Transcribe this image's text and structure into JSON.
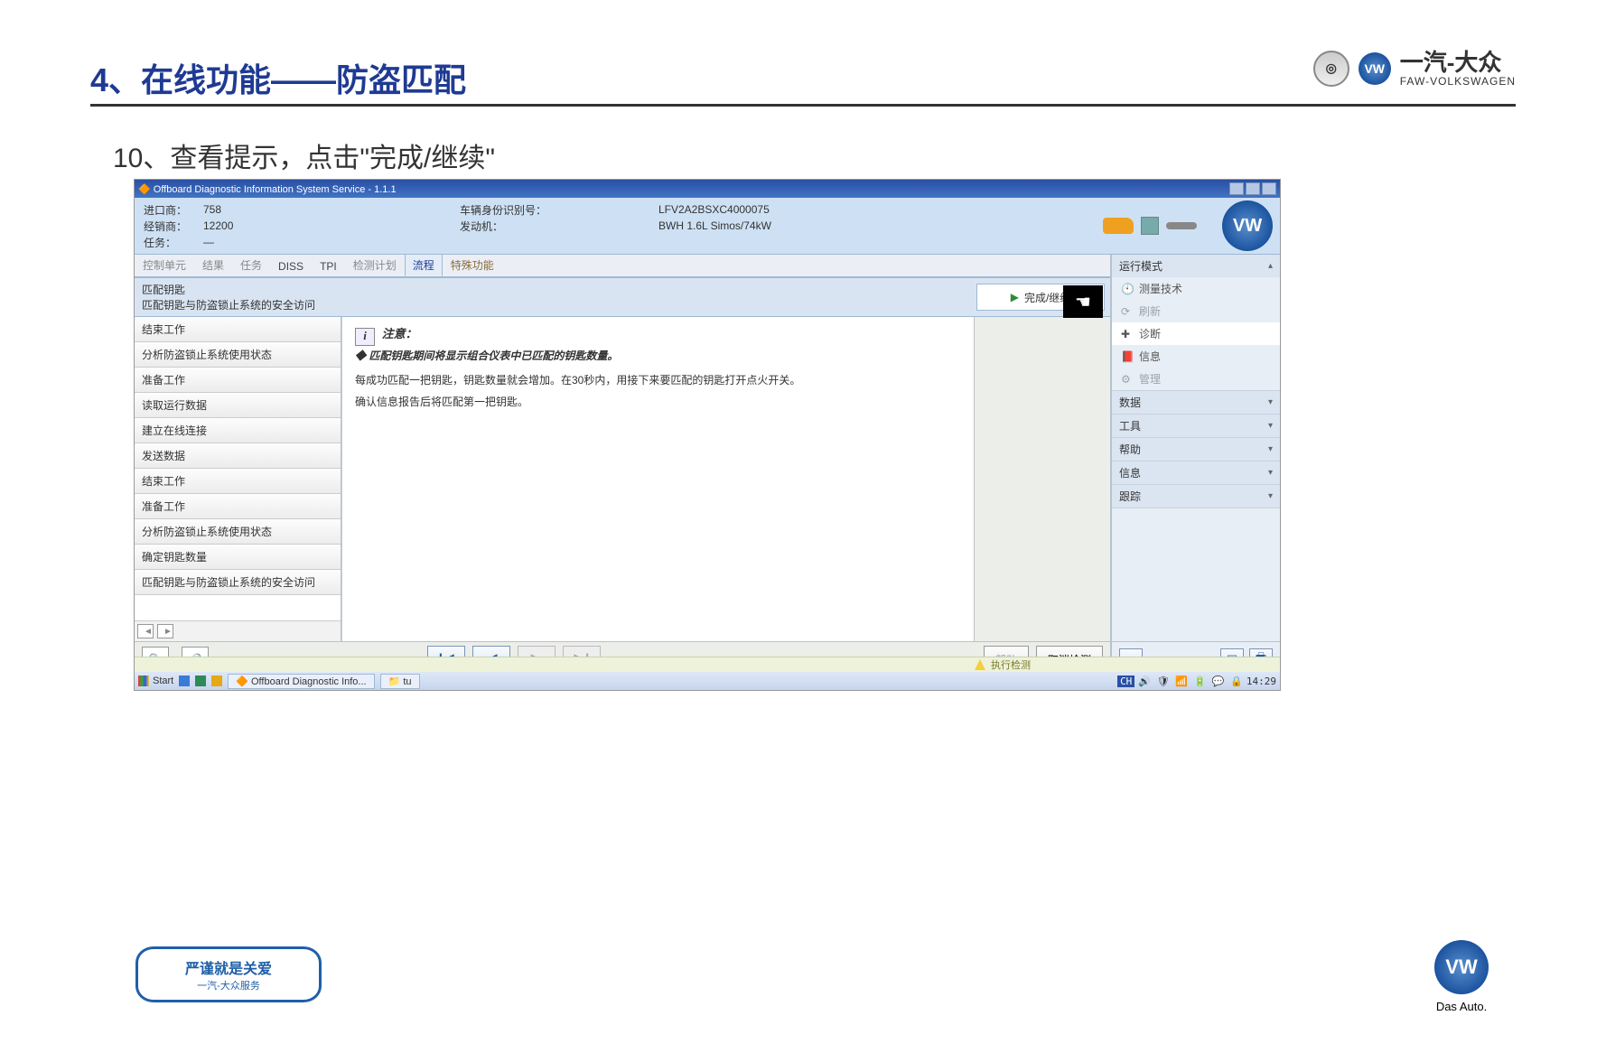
{
  "slide": {
    "title": "4、在线功能——防盗匹配",
    "subtitle": "10、查看提示，点击\"完成/继续\""
  },
  "brand": {
    "faw_vw_cn": "一汽-大众",
    "faw_vw_en": "FAW-VOLKSWAGEN",
    "badge_top": "严谨就是关爱",
    "badge_sub": "一汽-大众服务",
    "das_auto": "Das Auto."
  },
  "app": {
    "titlebar": "Offboard Diagnostic Information System Service - 1.1.1",
    "info": {
      "importer_label": "进口商：",
      "importer_value": "758",
      "dealer_label": "经销商：",
      "dealer_value": "12200",
      "task_label": "任务：",
      "task_value": "—",
      "vin_label": "车辆身份识别号：",
      "vin_value": "LFV2A2BSXC4000075",
      "engine_label": "发动机：",
      "engine_value": "BWH 1.6L Simos/74kW"
    },
    "tabs": [
      "控制单元",
      "结果",
      "任务",
      "DISS",
      "TPI",
      "检测计划",
      "流程",
      "特殊功能"
    ],
    "active_tab_index": 6,
    "step_title": "匹配钥匙",
    "step_subtitle": "匹配钥匙与防盗锁止系统的安全访问",
    "done_button": "完成/继续",
    "step_list": [
      "结束工作",
      "分析防盗锁止系统使用状态",
      "准备工作",
      "读取运行数据",
      "建立在线连接",
      "发送数据",
      "结束工作",
      "准备工作",
      "分析防盗锁止系统使用状态",
      "确定钥匙数量",
      "匹配钥匙与防盗锁止系统的安全访问"
    ],
    "content": {
      "note_label": "注意：",
      "bullet": "匹配钥匙期间将显示组合仪表中已匹配的钥匙数量。",
      "line1": "每成功匹配一把钥匙，钥匙数量就会增加。在30秒内，用接下来要匹配的钥匙打开点火开关。",
      "line2": "确认信息报告后将匹配第一把钥匙。"
    },
    "bottom": {
      "help": "帮助",
      "cancel": "取消检测"
    },
    "right_panel": {
      "mode_head": "运行模式",
      "mode_items": [
        "测量技术",
        "刷新",
        "诊断",
        "信息",
        "管理"
      ],
      "sections": [
        "数据",
        "工具",
        "帮助",
        "信息",
        "跟踪"
      ]
    },
    "status_text": "执行检测",
    "taskbar": {
      "start": "Start",
      "task1": "Offboard Diagnostic Info...",
      "task2": "tu",
      "lang": "CH",
      "time": "14:29"
    }
  }
}
